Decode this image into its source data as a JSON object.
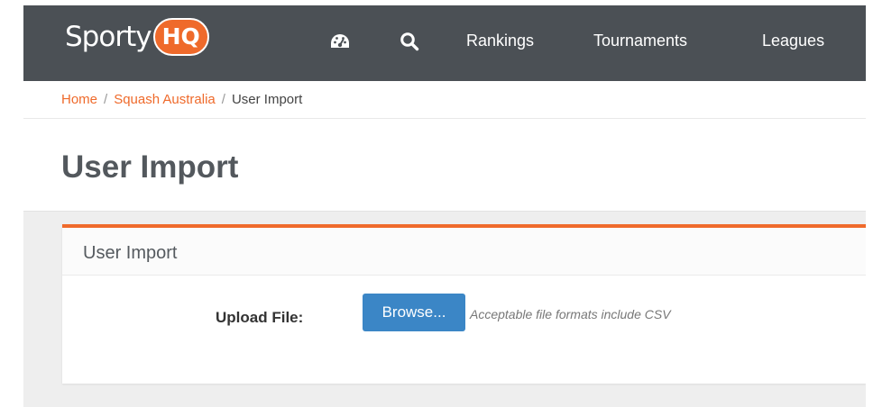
{
  "header": {
    "logo": {
      "text_left": "Sporty",
      "text_badge": "HQ"
    },
    "icons": [
      "dashboard-icon",
      "search-icon"
    ],
    "nav": [
      {
        "label": "Rankings"
      },
      {
        "label": "Tournaments"
      },
      {
        "label": "Leagues"
      }
    ]
  },
  "breadcrumb": {
    "items": [
      {
        "label": "Home"
      },
      {
        "label": "Squash Australia"
      },
      {
        "label": "User Import"
      }
    ],
    "separator": "/"
  },
  "page": {
    "title": "User Import"
  },
  "panel": {
    "title": "User Import",
    "upload_label": "Upload File:",
    "browse_label": "Browse...",
    "help_text": "Acceptable file formats include CSV"
  },
  "colors": {
    "navbar": "#4b5055",
    "accent": "#ef6a2b",
    "button": "#3b86c6",
    "content_bg": "#eeeeee"
  }
}
